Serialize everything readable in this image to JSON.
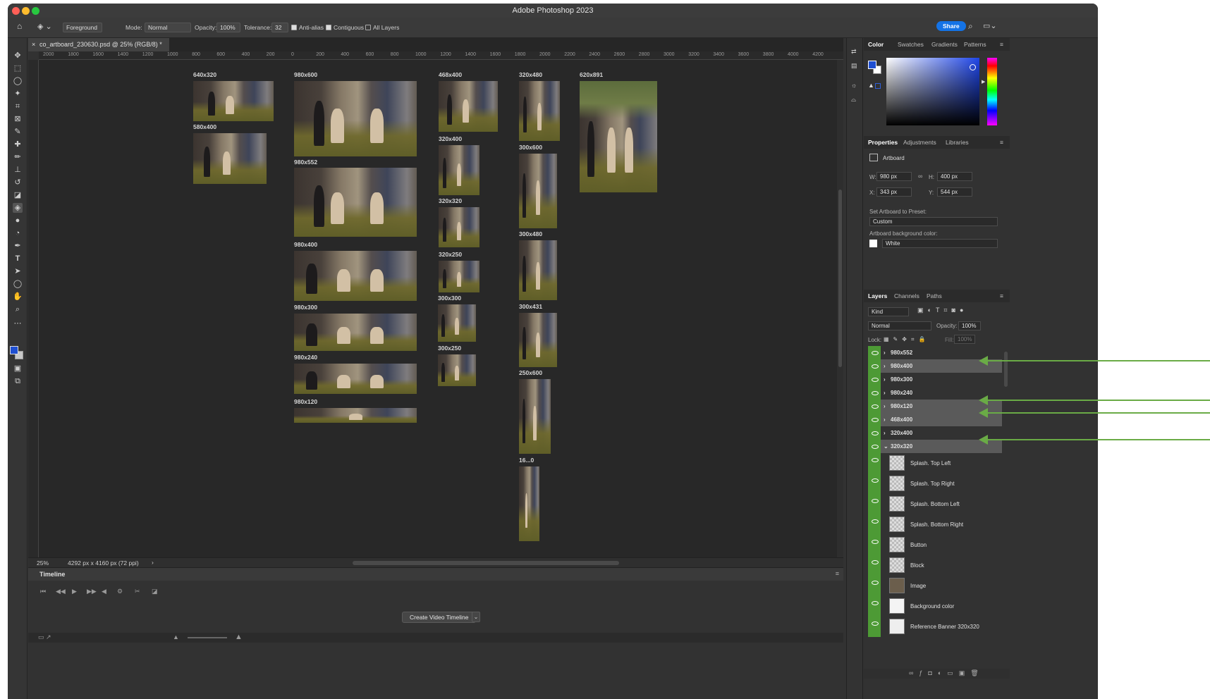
{
  "app": {
    "title": "Adobe Photoshop 2023"
  },
  "options_bar": {
    "preset": "Foreground",
    "mode_label": "Mode:",
    "mode_value": "Normal",
    "opacity_label": "Opacity:",
    "opacity_value": "100%",
    "tolerance_label": "Tolerance:",
    "tolerance_value": "32",
    "anti_alias": "Anti-alias",
    "contiguous": "Contiguous",
    "all_layers": "All Layers",
    "share": "Share"
  },
  "document": {
    "tab_title": "co_artboard_230630.psd @ 25% (RGB/8) *",
    "zoom": "25%",
    "doc_size": "4292 px x 4160 px (72 ppi)"
  },
  "ruler_labels": [
    "2000",
    "1800",
    "1600",
    "1400",
    "1200",
    "1000",
    "800",
    "600",
    "400",
    "200",
    "0",
    "200",
    "400",
    "600",
    "800",
    "1000",
    "1200",
    "1400",
    "1600",
    "1800",
    "2000",
    "2200",
    "2400",
    "2600",
    "2800",
    "3000",
    "3200",
    "3400",
    "3600",
    "3800",
    "4000",
    "4200"
  ],
  "artboards": [
    "640x320",
    "580x400",
    "980x600",
    "980x552",
    "980x400",
    "980x300",
    "980x240",
    "980x120",
    "468x400",
    "320x400",
    "320x320",
    "320x250",
    "300x300",
    "300x250",
    "320x480",
    "300x600",
    "300x480",
    "300x431",
    "250x600",
    "16...0",
    "620x891"
  ],
  "timeline": {
    "title": "Timeline",
    "create_button": "Create Video Timeline"
  },
  "color_panel": {
    "tabs": [
      "Color",
      "Swatches",
      "Gradients",
      "Patterns"
    ],
    "fg": "#1f4fd1",
    "bg": "#ffffff"
  },
  "properties_panel": {
    "tabs": [
      "Properties",
      "Adjustments",
      "Libraries"
    ],
    "section": "Artboard",
    "w_label": "W:",
    "w": "980 px",
    "h_label": "H:",
    "h": "400 px",
    "x_label": "X:",
    "x": "343 px",
    "y_label": "Y:",
    "y": "544 px",
    "preset_label": "Set Artboard to Preset:",
    "preset": "Custom",
    "bg_label": "Artboard background color:",
    "bg": "White"
  },
  "layers_panel": {
    "tabs": [
      "Layers",
      "Channels",
      "Paths"
    ],
    "filter": "Kind",
    "blend": "Normal",
    "opacity_label": "Opacity:",
    "opacity": "100%",
    "lock_label": "Lock:",
    "fill_label": "Fill:",
    "fill": "100%",
    "groups": [
      {
        "name": "980x552",
        "highlight": false
      },
      {
        "name": "980x400",
        "highlight": true
      },
      {
        "name": "980x300",
        "highlight": false
      },
      {
        "name": "980x240",
        "highlight": false
      },
      {
        "name": "980x120",
        "highlight": true
      },
      {
        "name": "468x400",
        "highlight": true
      },
      {
        "name": "320x400",
        "highlight": false
      },
      {
        "name": "320x320",
        "highlight": true
      }
    ],
    "children": [
      "Splash. Top Left",
      "Splash. Top Right",
      "Splash. Bottom Left",
      "Splash. Bottom Right",
      "Button",
      "Block",
      "Image",
      "Background color",
      "Reference Banner 320x320"
    ]
  },
  "annotation_color": "#6aab46"
}
